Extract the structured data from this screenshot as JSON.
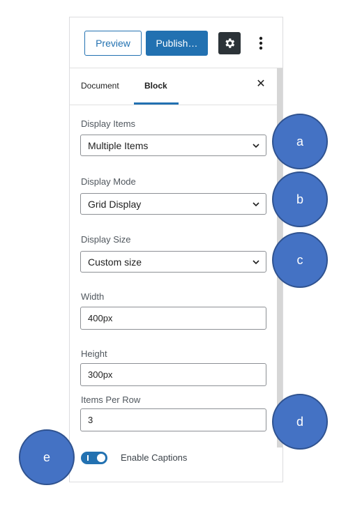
{
  "header": {
    "preview_label": "Preview",
    "publish_label": "Publish…",
    "settings_icon": "gear-icon",
    "more_icon": "kebab-icon"
  },
  "tabs": {
    "document_label": "Document",
    "block_label": "Block",
    "active": "Block",
    "close_label": "✕"
  },
  "settings": {
    "display_items": {
      "label": "Display Items",
      "value": "Multiple Items"
    },
    "display_mode": {
      "label": "Display Mode",
      "value": "Grid Display"
    },
    "display_size": {
      "label": "Display Size",
      "value": "Custom size"
    },
    "width": {
      "label": "Width",
      "value": "400px"
    },
    "height": {
      "label": "Height",
      "value": "300px"
    },
    "items_per_row": {
      "label": "Items Per Row",
      "value": "3"
    },
    "captions": {
      "label": "Enable Captions",
      "enabled": true
    }
  },
  "callouts": [
    "a",
    "b",
    "c",
    "d",
    "e"
  ],
  "colors": {
    "accent": "#2271b1",
    "callout": "#4472c4",
    "dark_button": "#2c3338"
  }
}
